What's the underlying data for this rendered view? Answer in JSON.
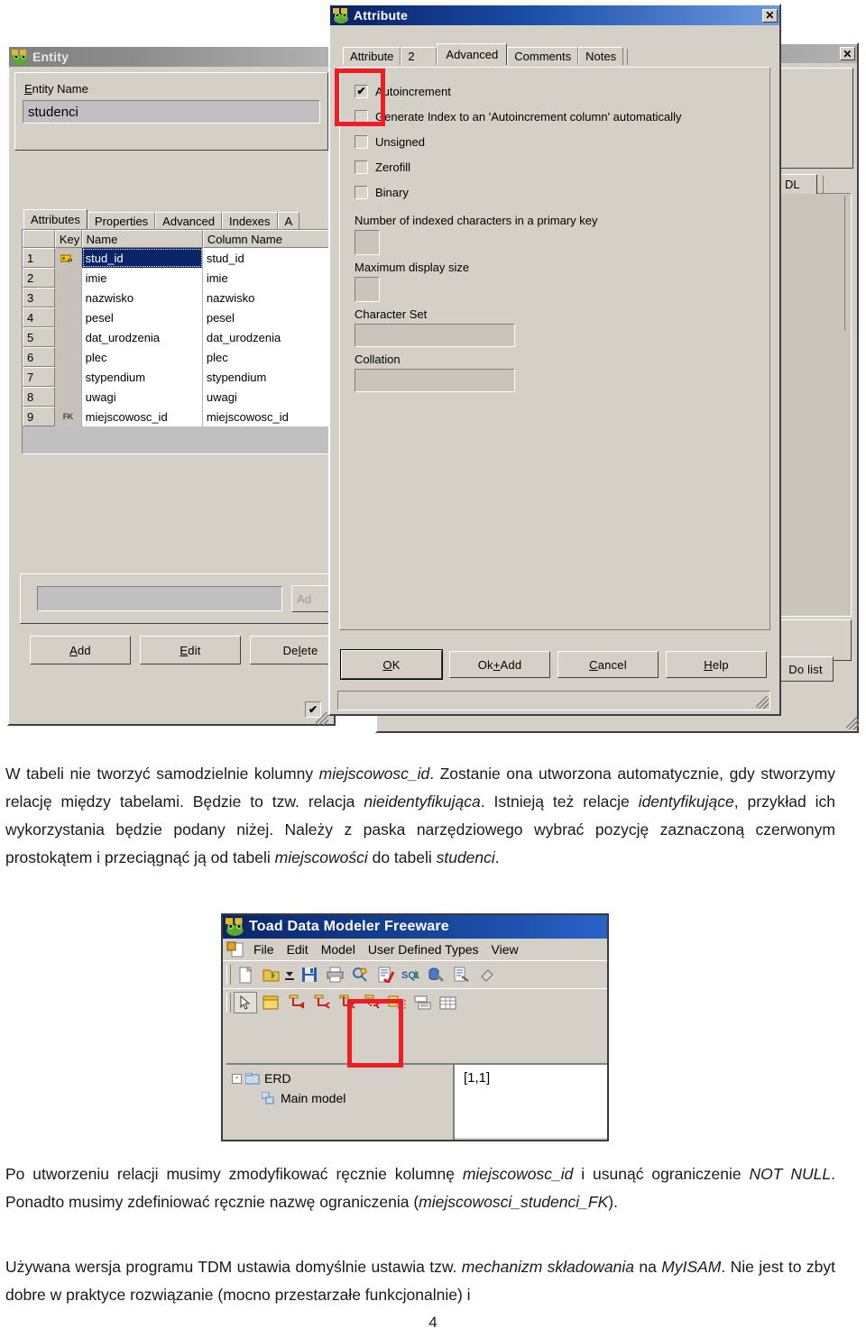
{
  "entity_dialog": {
    "title": "Entity",
    "icon": "frog-icon",
    "entity_name_label": "Entity Name",
    "entity_name_value": "studenci",
    "tabs": [
      "Attributes",
      "Properties",
      "Advanced",
      "Indexes",
      "A"
    ],
    "selected_tab": "Attributes",
    "grid": {
      "columns": [
        "",
        "Key",
        "Name",
        "Column Name"
      ],
      "rows": [
        {
          "num": "1",
          "key": "PK",
          "name": "stud_id",
          "column_name": "stud_id",
          "selected": true
        },
        {
          "num": "2",
          "key": "",
          "name": "imie",
          "column_name": "imie",
          "selected": false
        },
        {
          "num": "3",
          "key": "",
          "name": "nazwisko",
          "column_name": "nazwisko",
          "selected": false
        },
        {
          "num": "4",
          "key": "",
          "name": "pesel",
          "column_name": "pesel",
          "selected": false
        },
        {
          "num": "5",
          "key": "",
          "name": "dat_urodzenia",
          "column_name": "dat_urodzenia",
          "selected": false
        },
        {
          "num": "6",
          "key": "",
          "name": "plec",
          "column_name": "plec",
          "selected": false
        },
        {
          "num": "7",
          "key": "",
          "name": "stypendium",
          "column_name": "stypendium",
          "selected": false
        },
        {
          "num": "8",
          "key": "",
          "name": "uwagi",
          "column_name": "uwagi",
          "selected": false
        },
        {
          "num": "9",
          "key": "FK",
          "name": "miejscowosc_id",
          "column_name": "miejscowosc_id",
          "selected": false
        }
      ]
    },
    "quick_field_value": "",
    "quick_add_button": "Ad",
    "buttons": [
      "Add",
      "Edit",
      "Delete"
    ],
    "bottom_checkbox_checked": true
  },
  "attribute_dialog": {
    "title": "Attribute",
    "icon": "frog-icon",
    "close_label": "✕",
    "tabs": [
      "Attribute",
      "2",
      "Advanced",
      "Comments",
      "Notes"
    ],
    "selected_tab": "Advanced",
    "checkboxes": [
      {
        "label": "Autoincrement",
        "checked": true
      },
      {
        "label": "Generate Index to an 'Autoincrement column' automatically",
        "checked": false
      },
      {
        "label": "Unsigned",
        "checked": false
      },
      {
        "label": "Zerofill",
        "checked": false
      },
      {
        "label": "Binary",
        "checked": false
      }
    ],
    "fields": [
      {
        "label": "Number of indexed characters in a primary key",
        "value": "",
        "kind": "small"
      },
      {
        "label": "Maximum display size",
        "value": "",
        "kind": "small"
      },
      {
        "label": "Character Set",
        "value": "",
        "kind": "wide"
      },
      {
        "label": "Collation",
        "value": "",
        "kind": "wide"
      }
    ],
    "buttons": [
      "OK",
      "Ok+Add",
      "Cancel",
      "Help"
    ],
    "default_button": "OK",
    "highlight_color": "#ee1c25"
  },
  "background_window": {
    "close_label": "✕",
    "partial_tab": "DL",
    "do_list_button": "Do list"
  },
  "toad_window": {
    "title": "Toad Data Modeler Freeware",
    "icon": "frog-icon",
    "menu": [
      "File",
      "Edit",
      "Model",
      "User Defined Types",
      "View"
    ],
    "toolbar_row1": [
      "new-document-icon",
      "open-folder-icon",
      "dropdown-arrow-icon",
      "save-disk-icon",
      "print-icon",
      "search-model-icon",
      "verify-model-icon",
      "sql-icon",
      "reverse-engineer-icon",
      "report-icon",
      "eraser-icon"
    ],
    "toolbar_row2": [
      "pointer-icon",
      "entity-icon",
      "identifying-relationship-icon",
      "non-identifying-relationship-icon",
      "one-to-one-relationship-icon",
      "inheritance-relationship-icon",
      "note-link-icon",
      "view-icon",
      "table-icon"
    ],
    "highlighted_tool": "non-identifying-relationship-icon",
    "tree": [
      {
        "label": "ERD",
        "expander": "-",
        "icon": "folder-icon",
        "level": 0
      },
      {
        "label": "Main model",
        "expander": "",
        "icon": "model-icon",
        "level": 1
      }
    ],
    "coordinates_label": "[1,1]",
    "highlight_color": "#ee1c25"
  },
  "body_text": {
    "paragraph1_runs": [
      {
        "t": "W tabeli nie tworzyć samodzielnie kolumny "
      },
      {
        "t": "miejscowosc_id",
        "i": true
      },
      {
        "t": ". Zostanie ona utworzona automatycznie, gdy stworzymy relację między tabelami. Będzie to tzw. relacja "
      },
      {
        "t": "nieidentyfikująca",
        "i": true
      },
      {
        "t": ". Istnieją też relacje "
      },
      {
        "t": "identyfikujące",
        "i": true
      },
      {
        "t": ", przykład ich wykorzystania będzie podany niżej. Należy z paska narzędziowego wybrać pozycję zaznaczoną czerwonym prostokątem i przeciągnąć ją od tabeli "
      },
      {
        "t": "miejscowości",
        "i": true
      },
      {
        "t": " do tabeli "
      },
      {
        "t": "studenci",
        "i": true
      },
      {
        "t": "."
      }
    ],
    "paragraph2_runs": [
      {
        "t": "Po utworzeniu relacji musimy zmodyfikować ręcznie kolumnę "
      },
      {
        "t": "miejscowosc_id",
        "i": true
      },
      {
        "t": " i usunąć ograniczenie "
      },
      {
        "t": "NOT NULL",
        "i": true
      },
      {
        "t": ". Ponadto musimy zdefiniować ręcznie nazwę ograniczenia ("
      },
      {
        "t": "miejscowosci_studenci_FK",
        "i": true
      },
      {
        "t": ")."
      }
    ],
    "paragraph3_runs": [
      {
        "t": "Używana wersja programu TDM ustawia domyślnie ustawia tzw. "
      },
      {
        "t": "mechanizm składowania",
        "i": true
      },
      {
        "t": " na "
      },
      {
        "t": "MyISAM",
        "i": true
      },
      {
        "t": ". Nie jest to zbyt dobre w praktyce rozwiązanie (mocno przestarzałe funkcjonalnie) i"
      }
    ],
    "page_number": "4"
  }
}
